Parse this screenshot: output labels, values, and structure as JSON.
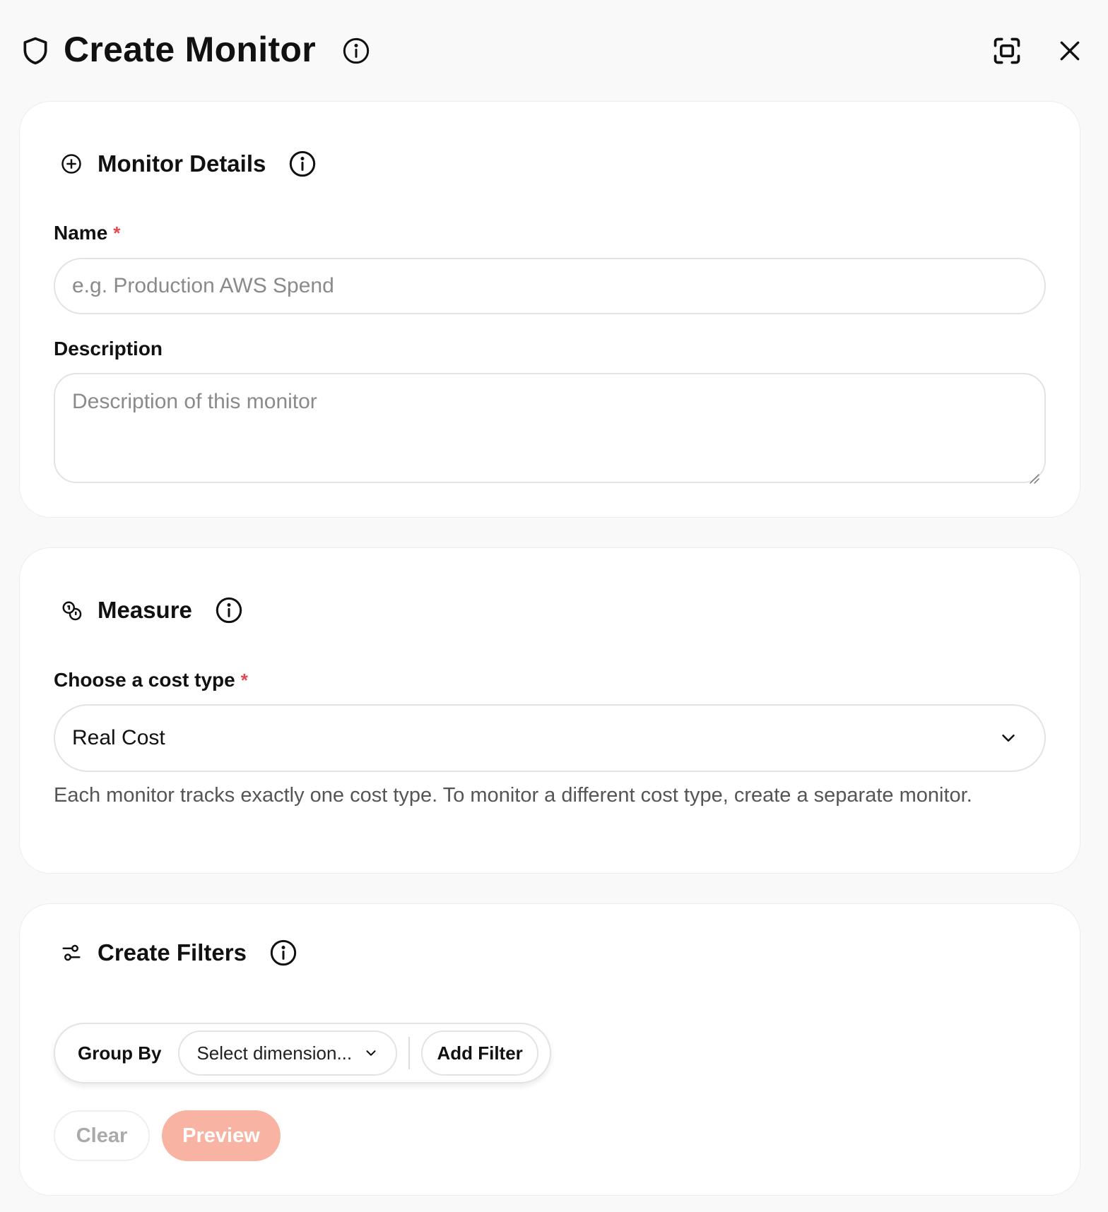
{
  "header": {
    "title": "Create Monitor",
    "icons": {
      "left": "shield-icon",
      "info": "info-icon",
      "fullscreen": "fullscreen-icon",
      "close": "close-icon"
    }
  },
  "details": {
    "title": "Monitor Details",
    "icon": "plus-circle-icon",
    "name_label": "Name",
    "required_mark": "*",
    "name_placeholder": "e.g. Production AWS Spend",
    "name_value": "",
    "description_label": "Description",
    "description_placeholder": "Description of this monitor",
    "description_value": ""
  },
  "measure": {
    "title": "Measure",
    "icon": "coins-icon",
    "cost_type_label": "Choose a cost type",
    "required_mark": "*",
    "cost_type_value": "Real Cost",
    "help_text": "Each monitor tracks exactly one cost type. To monitor a different cost type, create a separate monitor."
  },
  "filters": {
    "title": "Create Filters",
    "icon": "sliders-icon",
    "group_by_label": "Group By",
    "dimension_placeholder": "Select dimension...",
    "add_filter_label": "Add Filter",
    "clear_label": "Clear",
    "preview_label": "Preview"
  },
  "colors": {
    "required": "#e5484d",
    "preview_button": "#f9b3a3",
    "background": "#f9f9f9",
    "card": "#ffffff"
  }
}
